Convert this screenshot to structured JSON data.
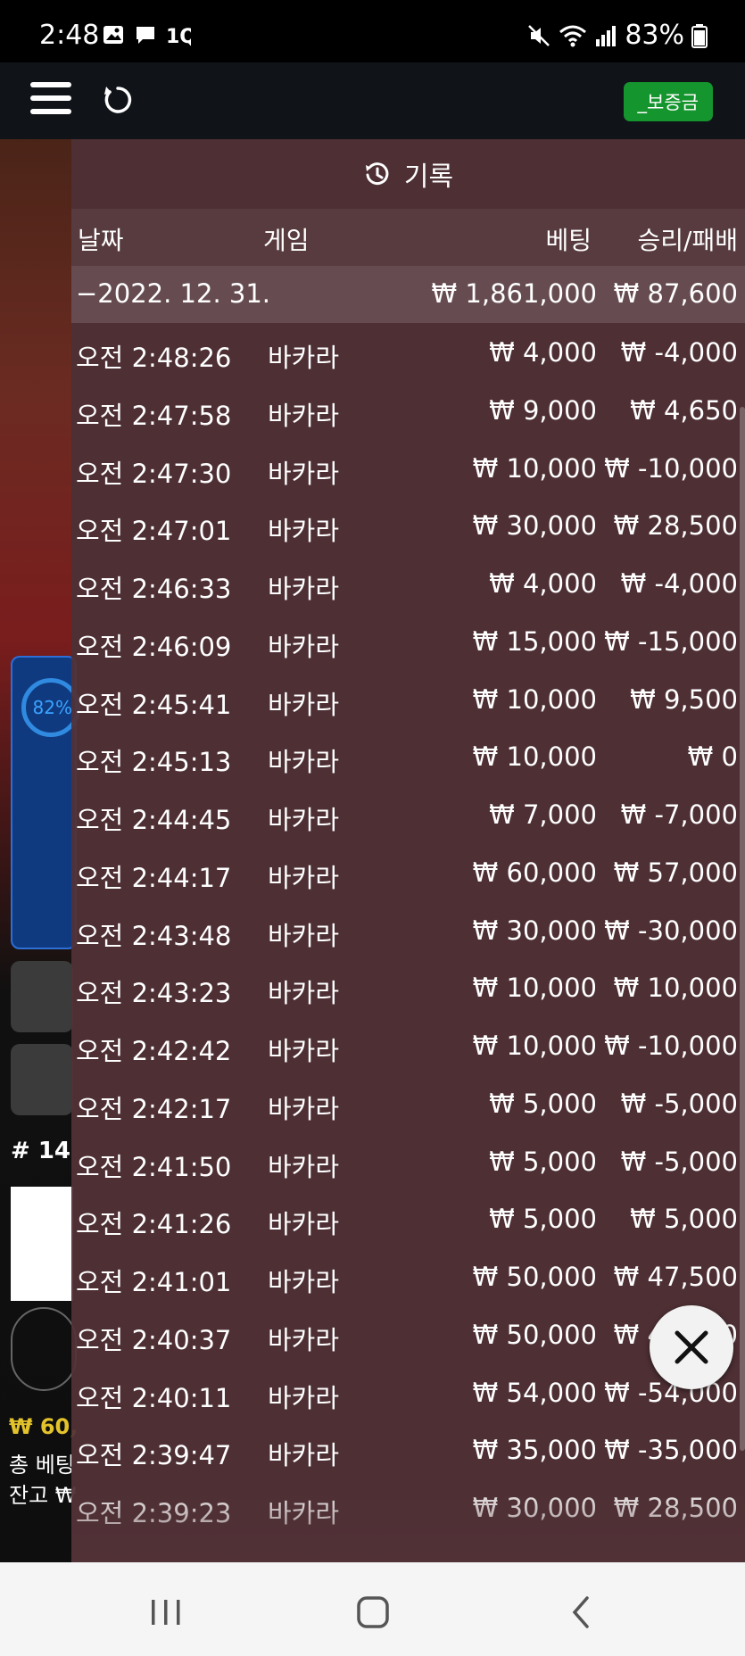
{
  "status_bar": {
    "time": "2:48",
    "battery": "83%",
    "icons_left": [
      "image-icon",
      "message-icon",
      "1q-icon"
    ],
    "icons_right": [
      "mute-icon",
      "wifi-icon",
      "signal-icon",
      "battery-icon"
    ]
  },
  "toolbar": {
    "deposit_label": "_보증금"
  },
  "history": {
    "title": "기록",
    "columns": {
      "date": "날짜",
      "game": "게임",
      "bet": "베팅",
      "result": "승리/패배"
    },
    "day_summary": {
      "date": "−2022. 12. 31.",
      "bet_total": "₩ 1,861,000",
      "result_total": "₩ 87,600"
    },
    "rows": [
      {
        "time": "오전 2:48:26",
        "game": "바카라",
        "bet": "₩ 4,000",
        "result": "₩ -4,000"
      },
      {
        "time": "오전 2:47:58",
        "game": "바카라",
        "bet": "₩ 9,000",
        "result": "₩ 4,650"
      },
      {
        "time": "오전 2:47:30",
        "game": "바카라",
        "bet": "₩ 10,000",
        "result": "₩ -10,000"
      },
      {
        "time": "오전 2:47:01",
        "game": "바카라",
        "bet": "₩ 30,000",
        "result": "₩ 28,500"
      },
      {
        "time": "오전 2:46:33",
        "game": "바카라",
        "bet": "₩ 4,000",
        "result": "₩ -4,000"
      },
      {
        "time": "오전 2:46:09",
        "game": "바카라",
        "bet": "₩ 15,000",
        "result": "₩ -15,000"
      },
      {
        "time": "오전 2:45:41",
        "game": "바카라",
        "bet": "₩ 10,000",
        "result": "₩ 9,500"
      },
      {
        "time": "오전 2:45:13",
        "game": "바카라",
        "bet": "₩ 10,000",
        "result": "₩ 0"
      },
      {
        "time": "오전 2:44:45",
        "game": "바카라",
        "bet": "₩ 7,000",
        "result": "₩ -7,000"
      },
      {
        "time": "오전 2:44:17",
        "game": "바카라",
        "bet": "₩ 60,000",
        "result": "₩ 57,000"
      },
      {
        "time": "오전 2:43:48",
        "game": "바카라",
        "bet": "₩ 30,000",
        "result": "₩ -30,000"
      },
      {
        "time": "오전 2:43:23",
        "game": "바카라",
        "bet": "₩ 10,000",
        "result": "₩ 10,000"
      },
      {
        "time": "오전 2:42:42",
        "game": "바카라",
        "bet": "₩ 10,000",
        "result": "₩ -10,000"
      },
      {
        "time": "오전 2:42:17",
        "game": "바카라",
        "bet": "₩ 5,000",
        "result": "₩ -5,000"
      },
      {
        "time": "오전 2:41:50",
        "game": "바카라",
        "bet": "₩ 5,000",
        "result": "₩ -5,000"
      },
      {
        "time": "오전 2:41:26",
        "game": "바카라",
        "bet": "₩ 5,000",
        "result": "₩ 5,000"
      },
      {
        "time": "오전 2:41:01",
        "game": "바카라",
        "bet": "₩ 50,000",
        "result": "₩ 47,500"
      },
      {
        "time": "오전 2:40:37",
        "game": "바카라",
        "bet": "₩ 50,000",
        "result": "₩ 47,500"
      },
      {
        "time": "오전 2:40:11",
        "game": "바카라",
        "bet": "₩ 54,000",
        "result": "₩ -54,000"
      },
      {
        "time": "오전 2:39:47",
        "game": "바카라",
        "bet": "₩ 35,000",
        "result": "₩ -35,000"
      },
      {
        "time": "오전 2:39:23",
        "game": "바카라",
        "bet": "₩ 30,000",
        "result": "₩ 28,500"
      }
    ]
  },
  "left_panel": {
    "percent": "82%",
    "round": "# 14",
    "bet_amount": "₩ 60,",
    "total_bet_label": "총 베팅",
    "balance_label": "잔고 ₩"
  },
  "colors": {
    "deposit_green": "#15952e",
    "panel_bg": "#523237",
    "accent_blue": "#2f8ae0",
    "gold": "#e3c32b"
  }
}
